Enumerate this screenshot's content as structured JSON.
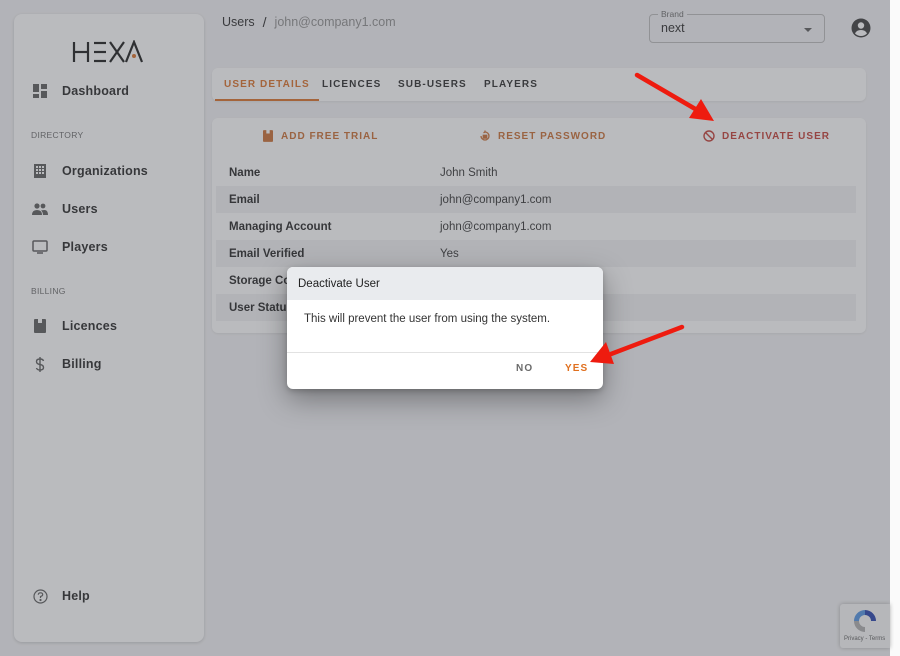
{
  "app": {
    "logo_text": "HEXA",
    "accent_color": "#d9691e",
    "danger_color": "#c2352c"
  },
  "sidebar": {
    "items_top": [
      {
        "label": "Dashboard",
        "icon": "dashboard-icon"
      }
    ],
    "sections": [
      {
        "label": "DIRECTORY",
        "items": [
          {
            "label": "Organizations",
            "icon": "building-icon"
          },
          {
            "label": "Users",
            "icon": "users-icon"
          },
          {
            "label": "Players",
            "icon": "monitor-icon"
          }
        ]
      },
      {
        "label": "BILLING",
        "items": [
          {
            "label": "Licences",
            "icon": "licence-icon"
          },
          {
            "label": "Billing",
            "icon": "dollar-icon"
          }
        ]
      }
    ],
    "help": {
      "label": "Help",
      "icon": "help-circle-icon"
    }
  },
  "header": {
    "breadcrumb": {
      "root": "Users",
      "separator": "/",
      "current": "john@company1.com"
    },
    "brand_select": {
      "legend": "Brand",
      "value": "next"
    },
    "account_icon": "account-circle-icon"
  },
  "tabs": [
    {
      "label": "USER DETAILS",
      "active": true
    },
    {
      "label": "LICENCES",
      "active": false
    },
    {
      "label": "SUB-USERS",
      "active": false
    },
    {
      "label": "PLAYERS",
      "active": false
    }
  ],
  "actions": [
    {
      "label": "ADD FREE TRIAL",
      "icon": "licence-icon"
    },
    {
      "label": "RESET PASSWORD",
      "icon": "lock-reset-icon"
    },
    {
      "label": "DEACTIVATE USER",
      "icon": "block-icon"
    }
  ],
  "details": [
    {
      "key": "Name",
      "value": "John Smith"
    },
    {
      "key": "Email",
      "value": "john@company1.com"
    },
    {
      "key": "Managing Account",
      "value": "john@company1.com"
    },
    {
      "key": "Email Verified",
      "value": "Yes"
    },
    {
      "key": "Storage Co",
      "value": ""
    },
    {
      "key": "User Statu",
      "value": ""
    }
  ],
  "dialog": {
    "title": "Deactivate User",
    "message": "This will prevent the user from using the system.",
    "no_label": "NO",
    "yes_label": "YES"
  },
  "recaptcha": {
    "label": "Privacy - Terms"
  }
}
